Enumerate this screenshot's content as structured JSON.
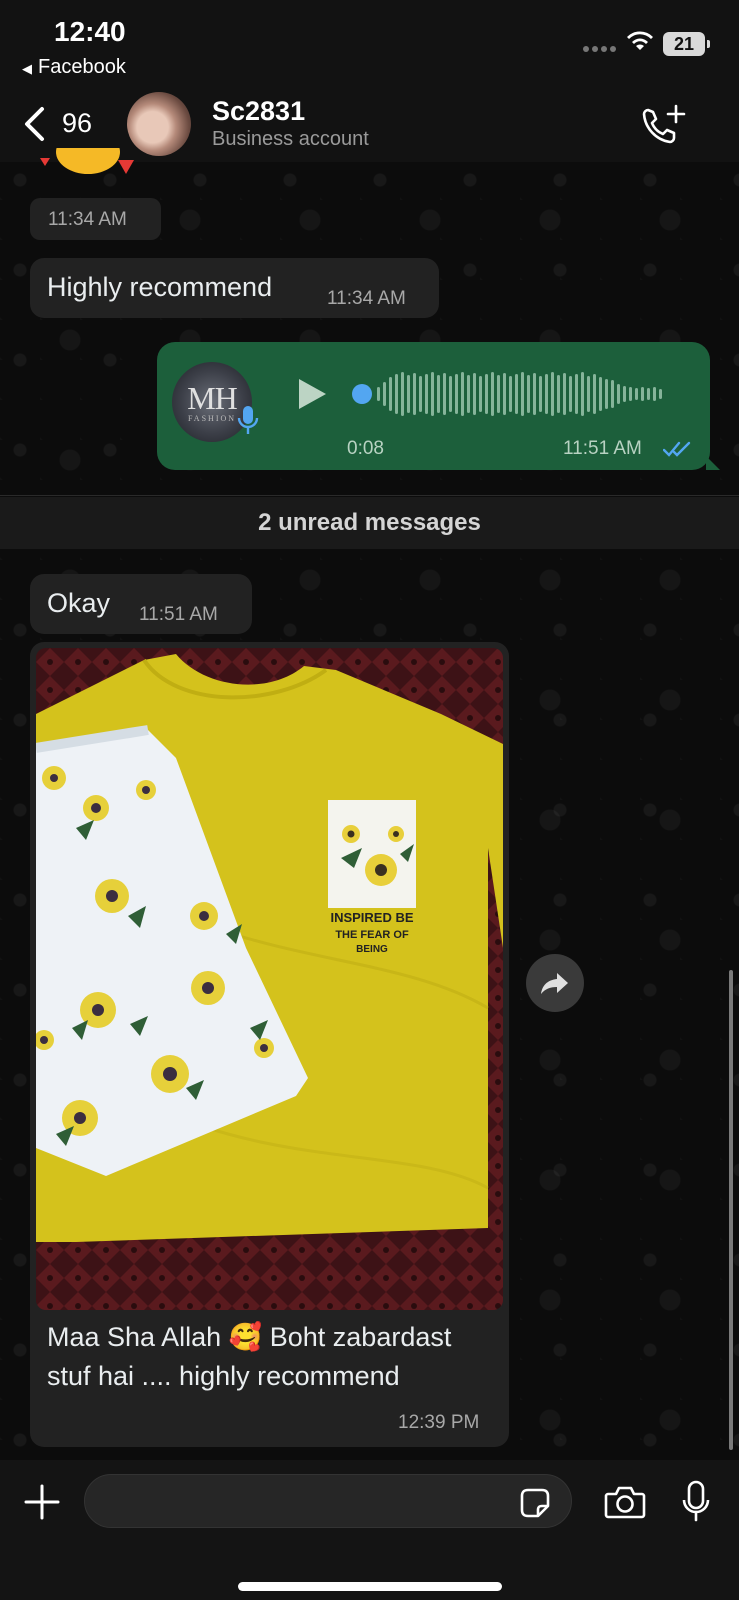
{
  "status_bar": {
    "time": "12:40",
    "back_app": "Facebook",
    "battery": "21"
  },
  "header": {
    "back_count": "96",
    "contact_name": "Sc2831",
    "contact_subtitle": "Business account"
  },
  "messages": [
    {
      "type": "timestamp_only",
      "time": "11:34 AM"
    },
    {
      "type": "text",
      "direction": "incoming",
      "text": "Highly recommend",
      "time": "11:34 AM"
    },
    {
      "type": "voice",
      "direction": "outgoing",
      "avatar_text": "MH",
      "avatar_subtext": "FASHION",
      "duration": "0:08",
      "time": "11:51 AM",
      "status": "read"
    },
    {
      "type": "text",
      "direction": "incoming",
      "text": "Okay",
      "time": "11:51 AM"
    },
    {
      "type": "image",
      "direction": "incoming",
      "image_text": [
        "INSPIRED BE",
        "THE FEAR OF",
        "BEING"
      ],
      "caption": "Maa Sha Allah 🥰 Boht zabardast stuf hai .... highly recommend",
      "time": "12:39 PM"
    }
  ],
  "unread_divider": "2 unread messages",
  "colors": {
    "outgoing_bubble": "#1c5f3b",
    "incoming_bubble": "#222222",
    "read_ticks": "#53a6f1",
    "tshirt": "#d9c81e"
  },
  "icons": [
    "back-chevron",
    "add-call",
    "play",
    "mic",
    "double-check",
    "forward",
    "plus",
    "sticker",
    "camera",
    "microphone"
  ]
}
